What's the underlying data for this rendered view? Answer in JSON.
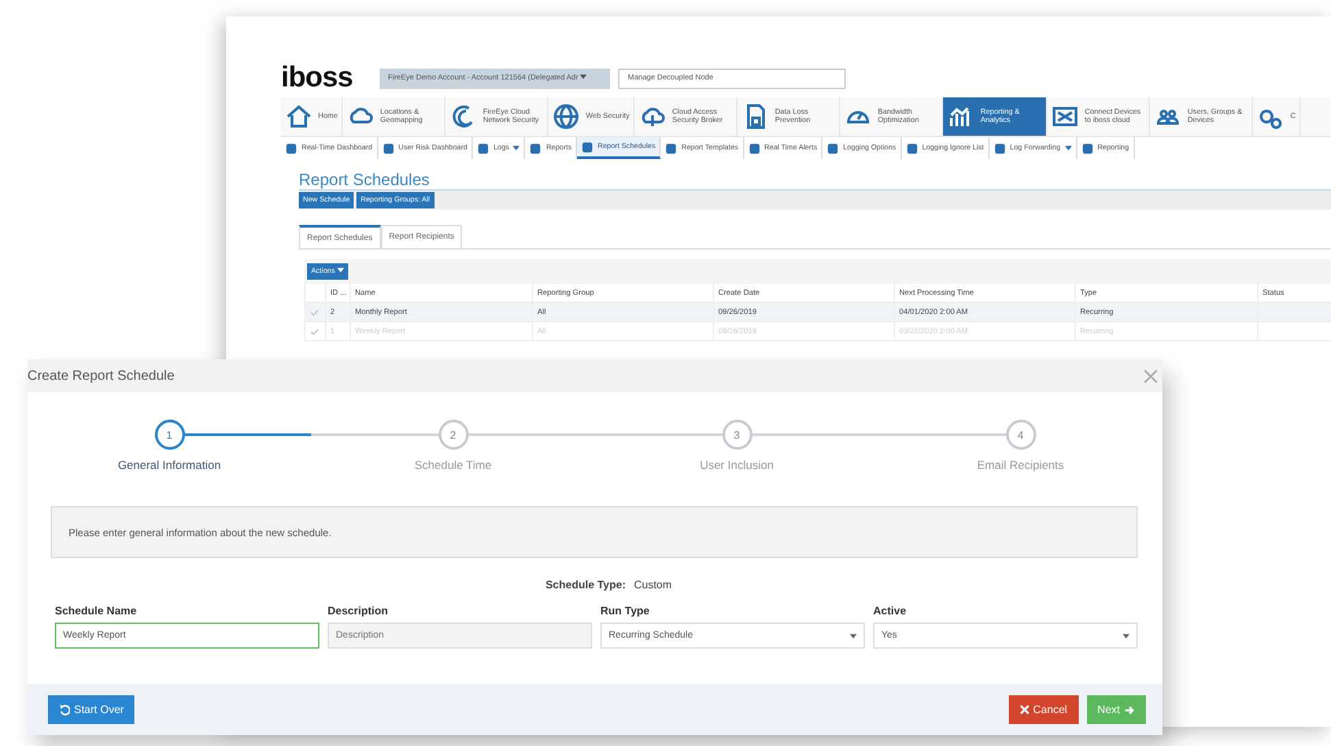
{
  "app": {
    "logo": "iboss",
    "account_dropdown": "FireEye Demo Account - Account 121564 (Delegated Adr",
    "node_dropdown": "Manage Decoupled Node",
    "main_nav": [
      {
        "label": "Home",
        "selected": false
      },
      {
        "label": "Locations & Geomapping",
        "selected": false
      },
      {
        "label": "FireEye Cloud Network Security",
        "selected": false
      },
      {
        "label": "Web Security",
        "selected": false
      },
      {
        "label": "Cloud Access Security Broker",
        "selected": false
      },
      {
        "label": "Data Loss Prevention",
        "selected": false
      },
      {
        "label": "Bandwidth Optimization",
        "selected": false
      },
      {
        "label": "Reporting & Analytics",
        "selected": true
      },
      {
        "label": "Connect Devices to iboss cloud",
        "selected": false
      },
      {
        "label": "Users, Groups & Devices",
        "selected": false
      },
      {
        "label": "C",
        "selected": false
      }
    ],
    "sub_nav": [
      {
        "label": "Real-Time Dashboard",
        "selected": false,
        "dropdown": false
      },
      {
        "label": "User Risk Dashboard",
        "selected": false,
        "dropdown": false
      },
      {
        "label": "Logs",
        "selected": false,
        "dropdown": true
      },
      {
        "label": "Reports",
        "selected": false,
        "dropdown": false
      },
      {
        "label": "Report Schedules",
        "selected": true,
        "dropdown": false
      },
      {
        "label": "Report Templates",
        "selected": false,
        "dropdown": false
      },
      {
        "label": "Real Time Alerts",
        "selected": false,
        "dropdown": false
      },
      {
        "label": "Logging Options",
        "selected": false,
        "dropdown": false
      },
      {
        "label": "Logging Ignore List",
        "selected": false,
        "dropdown": false
      },
      {
        "label": "Log Forwarding",
        "selected": false,
        "dropdown": true
      },
      {
        "label": "Reporting",
        "selected": false,
        "dropdown": false
      }
    ],
    "page_title": "Report Schedules",
    "toolbar_buttons": [
      "New Schedule",
      "Reporting Groups: All"
    ],
    "tabs": [
      {
        "label": "Report Schedules",
        "selected": true
      },
      {
        "label": "Report Recipients",
        "selected": false
      }
    ],
    "actions_button": "Actions",
    "table": {
      "columns": [
        "ID ...",
        "Name",
        "Reporting Group",
        "Create Date",
        "Next Processing Time",
        "Type",
        "Status"
      ],
      "rows": [
        {
          "dimmed": false,
          "cells": [
            "2",
            "Monthly Report",
            "All",
            "09/26/2019",
            "04/01/2020 2:00 AM",
            "Recurring",
            ""
          ]
        },
        {
          "dimmed": true,
          "cells": [
            "1",
            "Weekly Report",
            "All",
            "09/26/2019",
            "03/22/2020 2:00 AM",
            "Recurring",
            ""
          ]
        }
      ]
    }
  },
  "dialog": {
    "title": "Create Report Schedule",
    "steps": [
      {
        "number": "1",
        "label": "General Information",
        "selected": true
      },
      {
        "number": "2",
        "label": "Schedule Time",
        "selected": false
      },
      {
        "number": "3",
        "label": "User Inclusion",
        "selected": false
      },
      {
        "number": "4",
        "label": "Email Recipients",
        "selected": false
      }
    ],
    "info": "Please enter general information about the new schedule.",
    "schedule_type": {
      "label": "Schedule Type:",
      "value": "Custom"
    },
    "fields": [
      {
        "kind": "text",
        "label": "Schedule Name",
        "value": "Weekly Report",
        "focused": true,
        "disabled": false
      },
      {
        "kind": "text",
        "label": "Description",
        "placeholder": "Description",
        "focused": false,
        "disabled": true
      },
      {
        "kind": "select",
        "label": "Run Type",
        "value": "Recurring Schedule"
      },
      {
        "kind": "select",
        "label": "Active",
        "value": "Yes"
      }
    ],
    "start_over": "Start Over",
    "cancel": "Cancel",
    "next": "Next"
  }
}
